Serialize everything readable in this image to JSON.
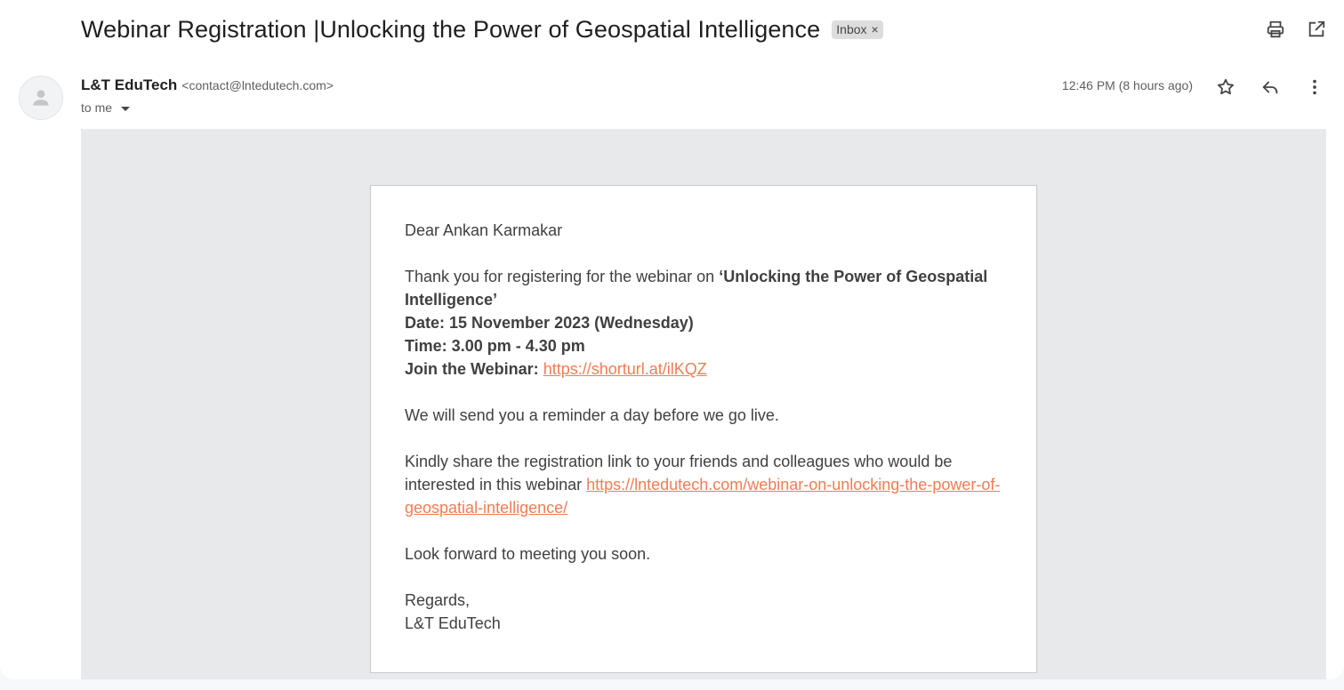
{
  "email": {
    "subject": "Webinar Registration |Unlocking the Power of Geospatial Intelligence",
    "label": "Inbox",
    "label_remove": "×",
    "sender_name": "L&T EduTech",
    "sender_email": "<contact@lntedutech.com>",
    "recipient": "to me",
    "timestamp": "12:46 PM (8 hours ago)"
  },
  "icons": {
    "print": "print-icon",
    "open_new_window": "open-in-new-window-icon",
    "star": "star-icon",
    "reply": "reply-icon",
    "more": "more-vertical-icon",
    "avatar": "person-avatar-icon"
  },
  "body": {
    "greeting": "Dear Ankan Karmakar",
    "thanks_prefix": "Thank you for registering for the webinar on ",
    "webinar_title": "‘Unlocking the Power of Geospatial Intelligence’",
    "date_line": "Date: 15 November 2023 (Wednesday)",
    "time_line": "Time: 3.00 pm - 4.30 pm",
    "join_label": "Join the Webinar: ",
    "join_link": "https://shorturl.at/ilKQZ",
    "reminder": "We will send you a reminder a day before we go live.",
    "share_prefix": "Kindly share the registration link to your friends and colleagues who would be interested in this webinar ",
    "share_link": "https://lntedutech.com/webinar-on-unlocking-the-power-of-geospatial-intelligence/",
    "closing": "Look forward to meeting you soon.",
    "regards": "Regards,",
    "signature": "L&T EduTech"
  },
  "colors": {
    "link": "#f37c54",
    "canvas": "#e8e9eb",
    "chip": "#dddddd"
  }
}
